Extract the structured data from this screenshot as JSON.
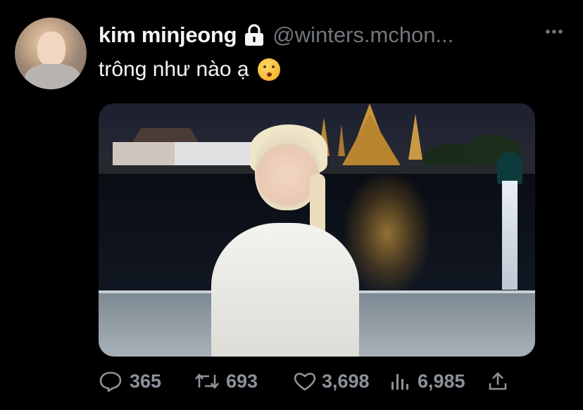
{
  "tweet": {
    "display_name": "kim minjeong",
    "handle": "@winters.mchon...",
    "text": "trông như nào ạ",
    "emoji_icon": "kissing-face-emoji",
    "protected_icon": "lock-icon"
  },
  "actions": {
    "replies": "365",
    "retweets": "693",
    "likes": "3,698",
    "views": "6,985"
  },
  "colors": {
    "background": "#000000",
    "text": "#f5f5f5",
    "muted": "#71767b",
    "action": "#8b9299"
  }
}
